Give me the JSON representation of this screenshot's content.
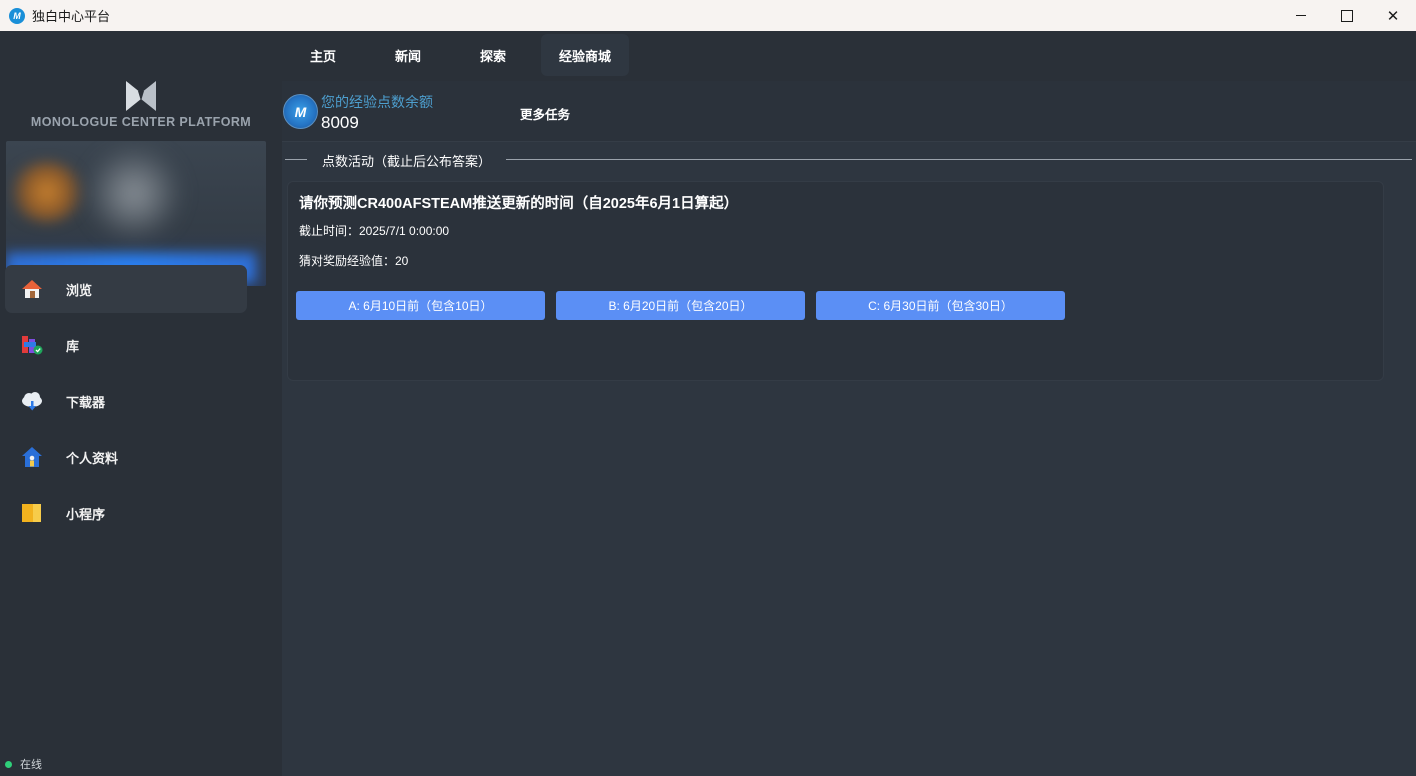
{
  "window": {
    "title": "独白中心平台",
    "app_icon": "M-logo-icon"
  },
  "sidebar": {
    "logo_text": "MONOLOGUE CENTER PLATFORM",
    "nav": [
      {
        "label": "浏览",
        "icon": "home-icon",
        "active": true
      },
      {
        "label": "库",
        "icon": "library-icon",
        "active": false
      },
      {
        "label": "下载器",
        "icon": "cloud-download-icon",
        "active": false
      },
      {
        "label": "个人资料",
        "icon": "profile-house-icon",
        "active": false
      },
      {
        "label": "小程序",
        "icon": "mini-program-icon",
        "active": false
      }
    ],
    "status": "在线"
  },
  "tabs": [
    {
      "label": "主页",
      "active": false
    },
    {
      "label": "新闻",
      "active": false
    },
    {
      "label": "探索",
      "active": false
    },
    {
      "label": "经验商城",
      "active": true
    }
  ],
  "points": {
    "label": "您的经验点数余额",
    "value": "8009",
    "more_tasks": "更多任务"
  },
  "section": {
    "title": "点数活动（截止后公布答案）"
  },
  "activity": {
    "title": "请你预测CR400AFSTEAM推送更新的时间（自2025年6月1日算起）",
    "deadline": "截止时间：2025/7/1 0:00:00",
    "reward": "猜对奖励经验值：20",
    "options": [
      "A: 6月10日前（包含10日）",
      "B: 6月20日前（包含20日）",
      "C: 6月30日前（包含30日）"
    ]
  },
  "colors": {
    "accent_button": "#5b8ff5",
    "points_label": "#4d9fcf",
    "online": "#2fd07a"
  }
}
